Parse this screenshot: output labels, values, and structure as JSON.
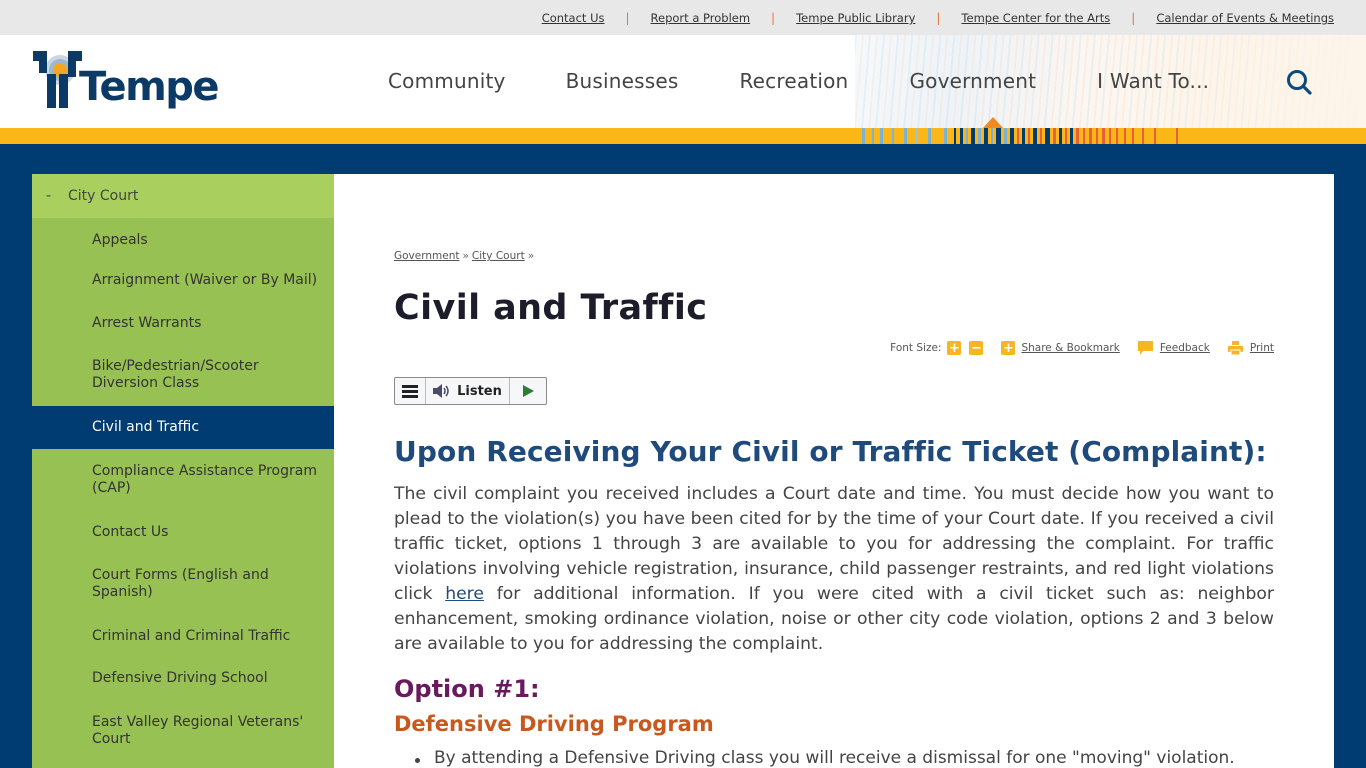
{
  "utility_links": [
    "Contact Us",
    "Report a Problem",
    "Tempe Public Library",
    "Tempe Center for the Arts",
    "Calendar of Events & Meetings"
  ],
  "logo": {
    "text": "Tempe"
  },
  "main_nav": {
    "items": [
      "Community",
      "Businesses",
      "Recreation",
      "Government",
      "I Want To..."
    ],
    "active": "Government",
    "search_icon": "search-icon"
  },
  "colors": {
    "navy": "#003b71",
    "gold": "#fbb717",
    "sidebar_green": "#98c153",
    "sidebar_parent_green": "#a9d05f",
    "heading_blue": "#1f4a7c",
    "option_purple": "#6a1a5c",
    "program_orange": "#c8581d",
    "accent_orange": "#f08a24"
  },
  "sidebar": {
    "parent": {
      "toggle": "-",
      "label": "City Court"
    },
    "items": [
      {
        "label": "Appeals"
      },
      {
        "label": "Arraignment (Waiver or By Mail)"
      },
      {
        "label": "Arrest Warrants"
      },
      {
        "label": "Bike/Pedestrian/Scooter Diversion Class"
      },
      {
        "label": "Civil and Traffic",
        "active": true
      },
      {
        "label": "Compliance Assistance Program (CAP)"
      },
      {
        "label": "Contact Us"
      },
      {
        "label": "Court Forms (English and Spanish)"
      },
      {
        "label": "Criminal and Criminal Traffic"
      },
      {
        "label": "Defensive Driving School"
      },
      {
        "label": "East Valley Regional Veterans' Court"
      }
    ]
  },
  "breadcrumb": {
    "items": [
      "Government",
      "City Court"
    ],
    "separator": "»"
  },
  "page_title": "Civil and Traffic",
  "tools": {
    "font_size_label": "Font Size:",
    "increase": "+",
    "decrease": "−",
    "share_label": "Share & Bookmark",
    "feedback_label": "Feedback",
    "print_label": "Print"
  },
  "listen": {
    "label": "Listen"
  },
  "section_heading": "Upon Receiving Your Civil or Traffic Ticket (Complaint):",
  "intro": {
    "before_link": "The civil complaint you received includes a Court date and time. You must decide how you want to plead to the violation(s) you have been cited for by the time of your Court date. If you received a civil traffic ticket, options 1 through 3 are available to you for addressing the complaint. For traffic violations involving vehicle registration, insurance, child passenger restraints, and red light violations click ",
    "link": "here",
    "after_link": " for additional information.   If you were cited with a civil ticket such as: neighbor enhancement, smoking ordinance violation, noise or other city code violation, options 2 and 3 below are available to you for addressing the complaint."
  },
  "option_heading": "Option #1:",
  "program_heading": "Defensive Driving Program",
  "bullets": [
    "By attending a Defensive Driving class you will receive a dismissal for one \"moving\" violation."
  ]
}
